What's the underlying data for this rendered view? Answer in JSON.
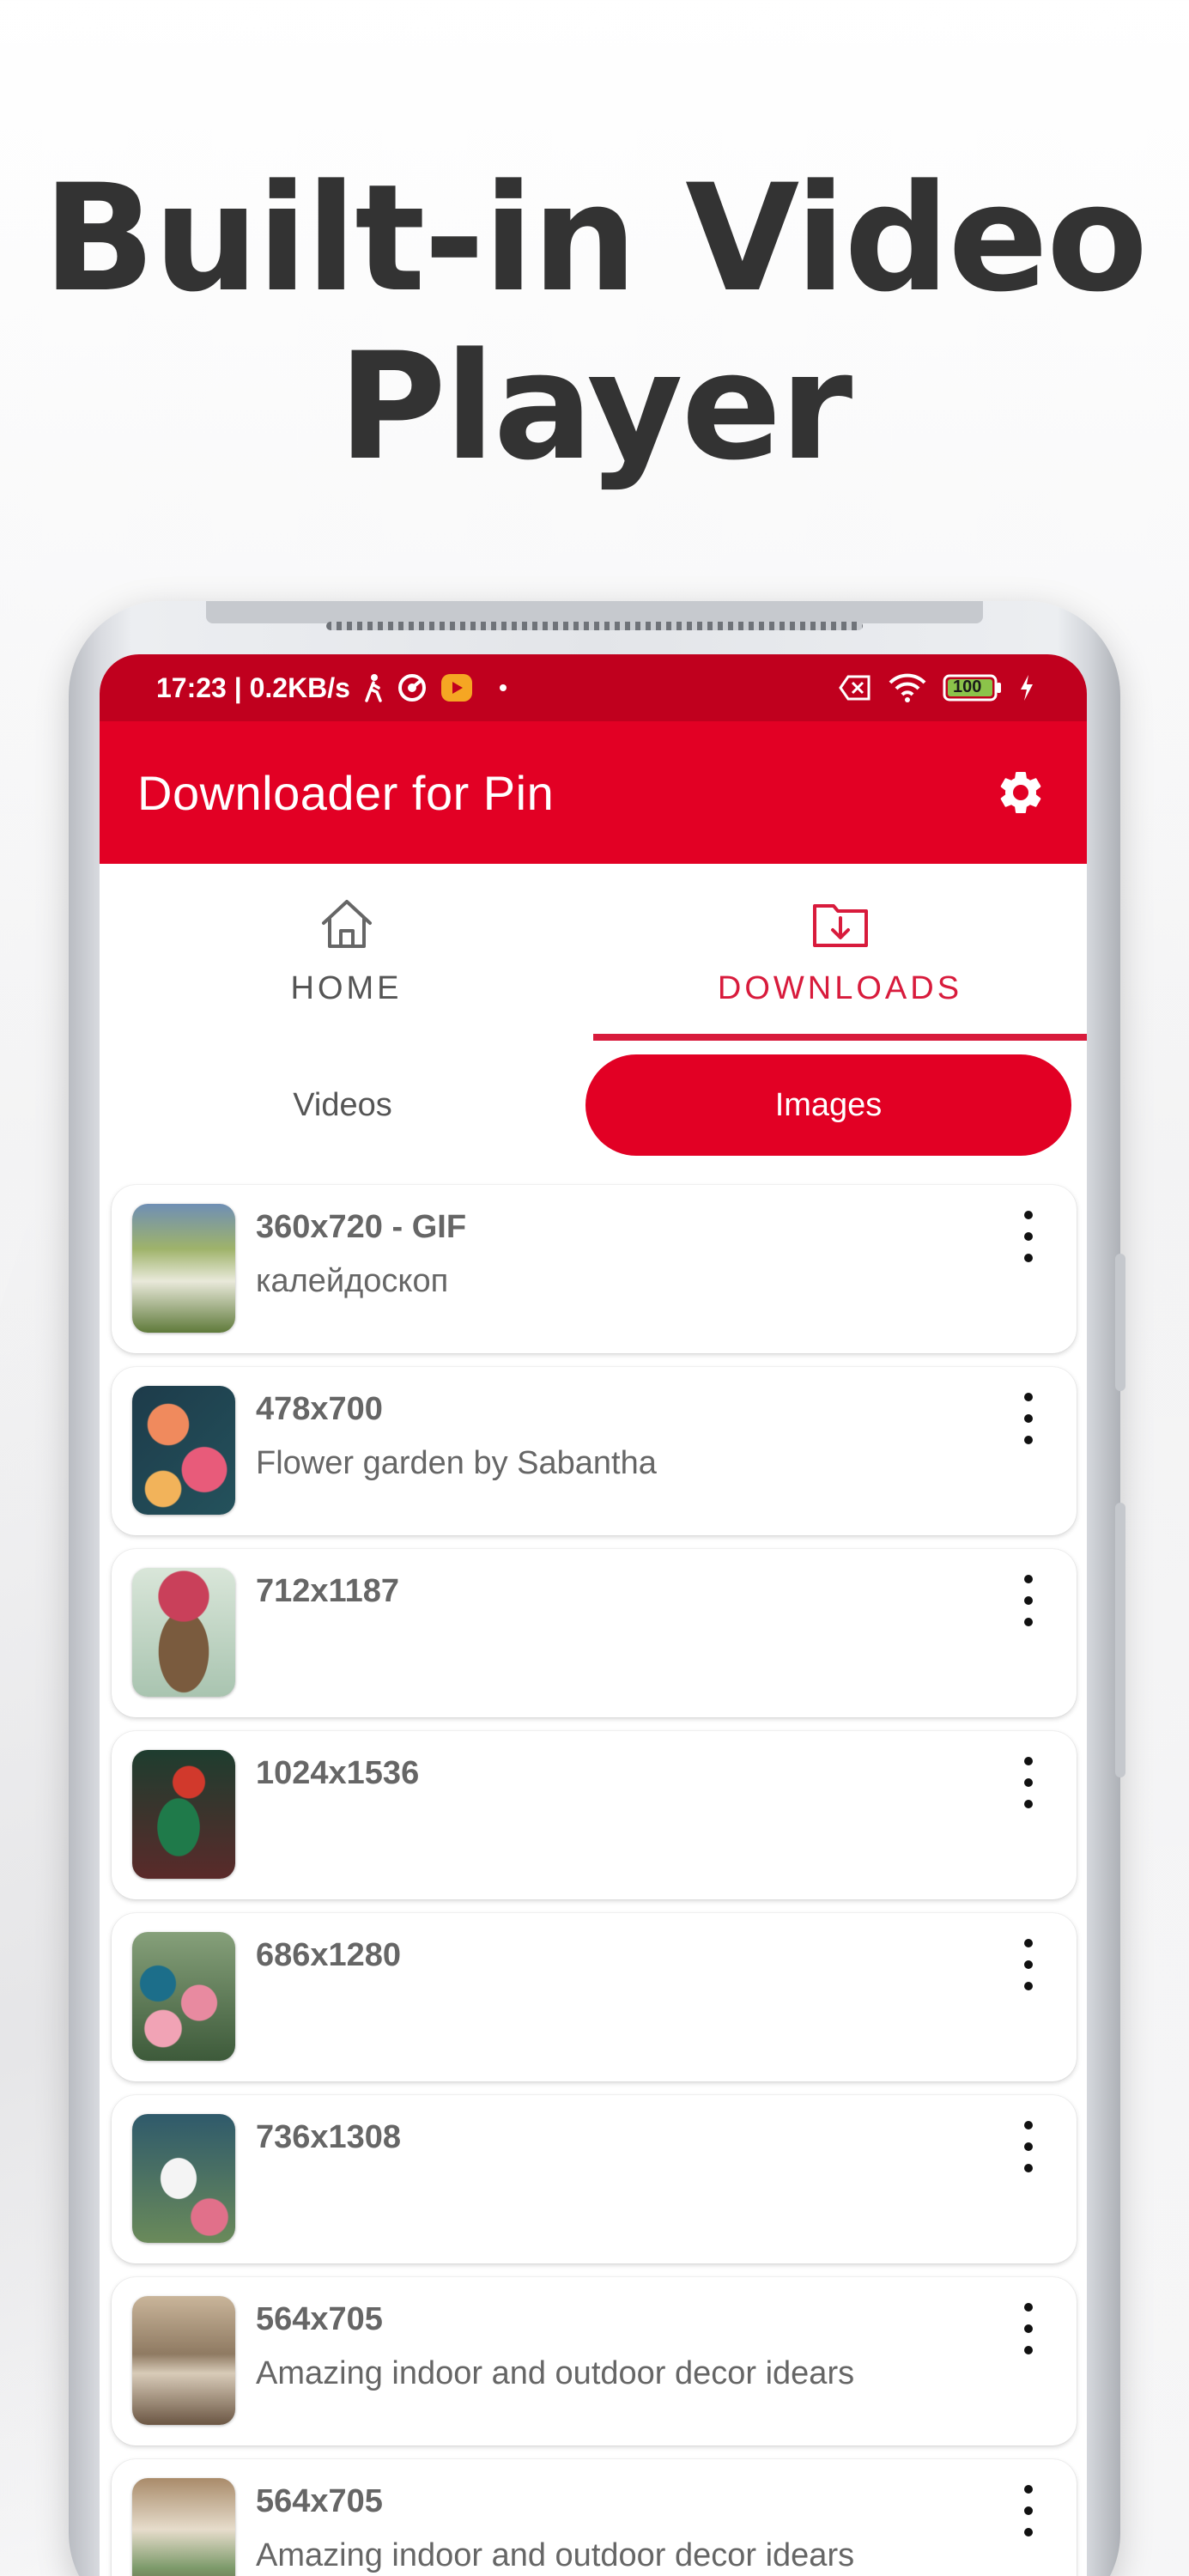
{
  "headline": {
    "line1": "Built-in Video",
    "line2": "Player"
  },
  "status_bar": {
    "time_and_speed": "17:23 | 0.2KB/s",
    "battery": "100",
    "icons": [
      "walk-icon",
      "vpn-key-icon",
      "youtube-icon",
      "dot-icon",
      "sim-off-icon",
      "wifi-icon",
      "battery-icon",
      "charging-icon"
    ]
  },
  "app_bar": {
    "title": "Downloader for Pin",
    "settings_icon": "gear-icon"
  },
  "tabs": [
    {
      "label": "HOME",
      "icon": "home-icon",
      "active": false
    },
    {
      "label": "DOWNLOADS",
      "icon": "download-folder-icon",
      "active": true
    }
  ],
  "segments": [
    {
      "label": "Videos",
      "active": false
    },
    {
      "label": "Images",
      "active": true
    }
  ],
  "items": [
    {
      "size": "360x720 - GIF",
      "title": "калейдоскоп"
    },
    {
      "size": "478x700",
      "title": "Flower garden by Sabantha"
    },
    {
      "size": "712x1187",
      "title": ""
    },
    {
      "size": "1024x1536",
      "title": ""
    },
    {
      "size": "686x1280",
      "title": ""
    },
    {
      "size": "736x1308",
      "title": ""
    },
    {
      "size": "564x705",
      "title": "Amazing indoor and outdoor decor idears"
    },
    {
      "size": "564x705",
      "title": "Amazing indoor and outdoor decor idears"
    }
  ],
  "colors": {
    "brand_red": "#e20024",
    "status_red": "#c0001e",
    "accent": "#d81b3c",
    "headline": "#333333"
  }
}
